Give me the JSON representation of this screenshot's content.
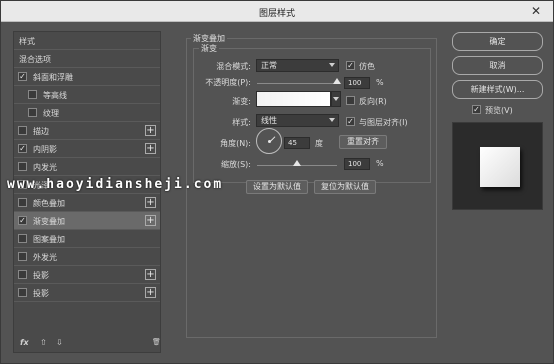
{
  "window": {
    "title": "图层样式",
    "close_glyph": "✕"
  },
  "left_list": {
    "header": "样式",
    "blend_options": "混合选项",
    "items": [
      {
        "label": "斜面和浮雕",
        "checked": true,
        "plus": false,
        "indent": false
      },
      {
        "label": "等高线",
        "checked": false,
        "plus": false,
        "indent": true
      },
      {
        "label": "纹理",
        "checked": false,
        "plus": false,
        "indent": true
      },
      {
        "label": "描边",
        "checked": false,
        "plus": true,
        "indent": false
      },
      {
        "label": "内阴影",
        "checked": true,
        "plus": true,
        "indent": false
      },
      {
        "label": "内发光",
        "checked": false,
        "plus": false,
        "indent": false
      },
      {
        "label": "光泽",
        "checked": false,
        "plus": false,
        "indent": false
      },
      {
        "label": "颜色叠加",
        "checked": false,
        "plus": true,
        "indent": false
      },
      {
        "label": "渐变叠加",
        "checked": true,
        "plus": true,
        "indent": false,
        "selected": true
      },
      {
        "label": "图案叠加",
        "checked": false,
        "plus": false,
        "indent": false
      },
      {
        "label": "外发光",
        "checked": false,
        "plus": false,
        "indent": false
      },
      {
        "label": "投影",
        "checked": false,
        "plus": true,
        "indent": false
      },
      {
        "label": "投影",
        "checked": false,
        "plus": true,
        "indent": false
      }
    ],
    "footer": {
      "fx": "fx",
      "up": "⇧",
      "down": "⇩",
      "trash": "🗑"
    }
  },
  "panel": {
    "group_title": "渐变叠加",
    "subgroup_title": "渐变",
    "blend_mode_label": "混合模式:",
    "blend_mode_value": "正常",
    "dither_label": "仿色",
    "opacity_label": "不透明度(P):",
    "opacity_value": "100",
    "opacity_unit": "%",
    "gradient_label": "渐变:",
    "reverse_label": "反向(R)",
    "style_label": "样式:",
    "style_value": "线性",
    "align_label": "与图层对齐(I)",
    "angle_label": "角度(N):",
    "angle_value": "45",
    "angle_unit": "度",
    "reset_align_label": "重置对齐",
    "scale_label": "缩放(S):",
    "scale_value": "100",
    "scale_unit": "%",
    "set_default_label": "设置为默认值",
    "reset_default_label": "复位为默认值",
    "opacity_level": 1.0,
    "scale_level": 0.5
  },
  "right": {
    "ok": "确定",
    "cancel": "取消",
    "new_style": "新建样式(W)...",
    "preview_label": "预览(V)",
    "preview_checked": true
  },
  "watermark": "www.haoyidiansheji.com"
}
